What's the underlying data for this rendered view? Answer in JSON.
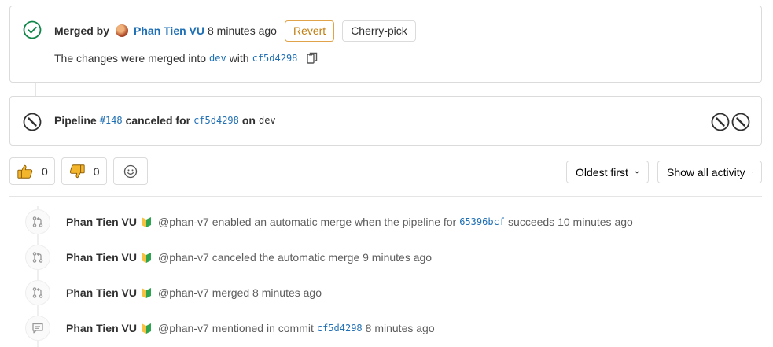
{
  "merge": {
    "merged_by_label": "Merged by",
    "author": "Phan Tien VU",
    "time": "8 minutes ago",
    "revert_label": "Revert",
    "cherry_pick_label": "Cherry-pick",
    "changes_text": "The changes were merged into",
    "target_branch": "dev",
    "with_text": "with",
    "commit_sha": "cf5d4298"
  },
  "pipeline": {
    "label": "Pipeline",
    "id": "#148",
    "status_text": "canceled for",
    "commit_sha": "cf5d4298",
    "on_text": "on",
    "branch": "dev"
  },
  "reactions": {
    "thumbs_up_count": "0",
    "thumbs_down_count": "0"
  },
  "sort": {
    "label": "Oldest first"
  },
  "filter": {
    "label": "Show all activity"
  },
  "activity": [
    {
      "icon": "merge-request-icon",
      "author": "Phan Tien VU",
      "handle": "@phan-v7",
      "text_before": "enabled an automatic merge when the pipeline for",
      "sha": "65396bcf",
      "text_after": "succeeds 10 minutes ago"
    },
    {
      "icon": "merge-request-icon",
      "author": "Phan Tien VU",
      "handle": "@phan-v7",
      "text_before": "canceled the automatic merge 9 minutes ago"
    },
    {
      "icon": "merge-request-icon",
      "author": "Phan Tien VU",
      "handle": "@phan-v7",
      "text_before": "merged 8 minutes ago"
    },
    {
      "icon": "comment-icon",
      "author": "Phan Tien VU",
      "handle": "@phan-v7",
      "text_before": "mentioned in commit",
      "sha": "cf5d4298",
      "text_after": "8 minutes ago"
    }
  ],
  "colors": {
    "success": "#108548",
    "link": "#1f6fb5",
    "warning": "#c17d10"
  }
}
